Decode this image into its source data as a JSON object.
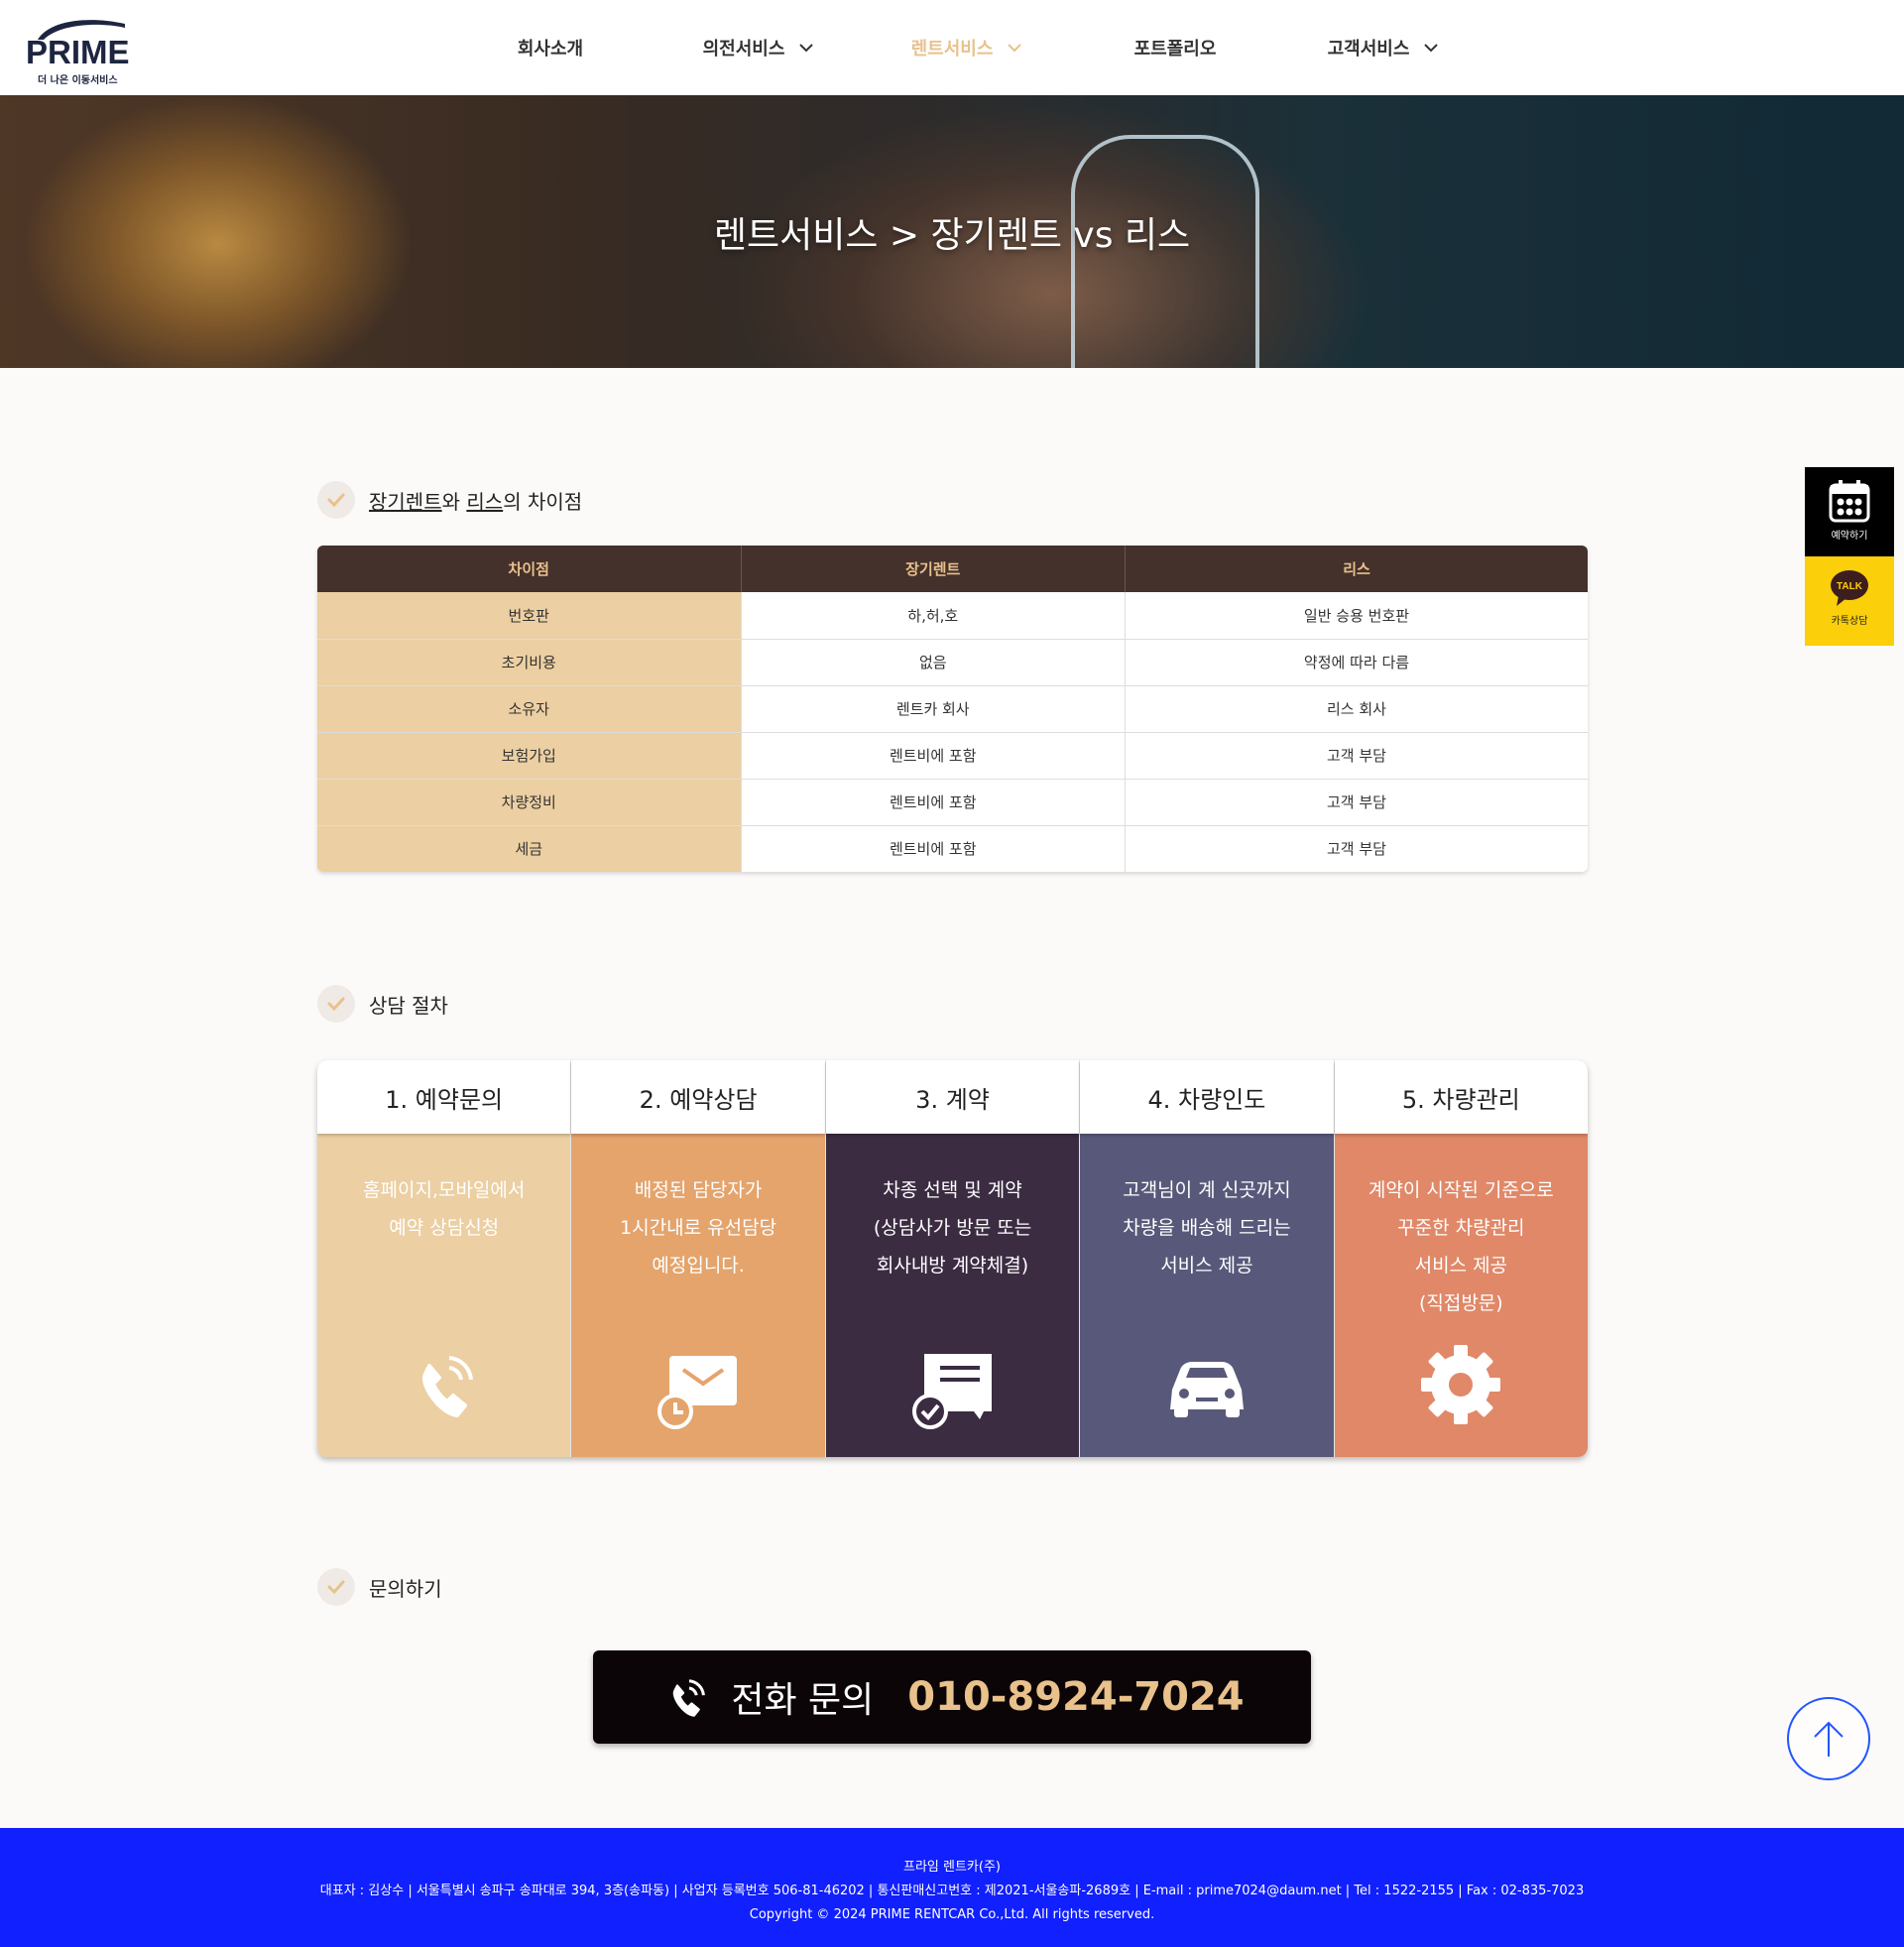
{
  "header": {
    "logo_text": "PRIME",
    "logo_tagline": "더 나은 이동서비스",
    "nav": [
      {
        "label": "회사소개",
        "has_dropdown": false,
        "active": false
      },
      {
        "label": "의전서비스",
        "has_dropdown": true,
        "active": false
      },
      {
        "label": "렌트서비스",
        "has_dropdown": true,
        "active": true
      },
      {
        "label": "포트폴리오",
        "has_dropdown": false,
        "active": false
      },
      {
        "label": "고객서비스",
        "has_dropdown": true,
        "active": false
      }
    ]
  },
  "hero": {
    "title": "렌트서비스 > 장기렌트 vs 리스"
  },
  "comparison": {
    "title_part1": "장기렌트",
    "title_part2": "와 ",
    "title_part3": "리스",
    "title_part4": "의 차이점",
    "headers": [
      "차이점",
      "장기렌트",
      "리스"
    ],
    "rows": [
      [
        "번호판",
        "하,허,호",
        "일반 승용 번호판"
      ],
      [
        "초기비용",
        "없음",
        "약정에 따라 다름"
      ],
      [
        "소유자",
        "렌트카 회사",
        "리스 회사"
      ],
      [
        "보험가입",
        "렌트비에 포함",
        "고객 부담"
      ],
      [
        "차량정비",
        "렌트비에 포함",
        "고객 부담"
      ],
      [
        "세금",
        "렌트비에 포함",
        "고객 부담"
      ]
    ]
  },
  "procedure": {
    "title": "상담 절차",
    "steps": [
      {
        "title": "1. 예약문의",
        "lines": [
          "홈페이지,모바일에서",
          "예약 상담신청"
        ],
        "icon": "phone-icon"
      },
      {
        "title": "2. 예약상담",
        "lines": [
          "배정된 담당자가",
          "1시간내로 유선담당",
          "예정입니다."
        ],
        "icon": "mail-clock-icon"
      },
      {
        "title": "3. 계약",
        "lines": [
          "차종 선택 및 계약",
          "(상담사가 방문 또는",
          "회사내방 계약체결)"
        ],
        "icon": "contract-check-icon"
      },
      {
        "title": "4. 차량인도",
        "lines": [
          "고객님이 계 신곳까지",
          "차량을 배송해 드리는",
          "서비스 제공"
        ],
        "icon": "car-icon"
      },
      {
        "title": "5. 차량관리",
        "lines": [
          "계약이 시작된 기준으로",
          "꾸준한 차량관리",
          "서비스 제공",
          "(직접방문)"
        ],
        "icon": "gear-icon"
      }
    ]
  },
  "inquiry": {
    "title": "문의하기",
    "phone_label": "전화 문의",
    "phone_number": "010-8924-7024"
  },
  "floats": {
    "book_label": "예약하기",
    "talk_badge": "TALK",
    "talk_label": "카톡상담"
  },
  "footer": {
    "company": "프라임 렌트카(주)",
    "info": "대표자 : 김상수 | 서울특별시 송파구 송파대로 394, 3층(송파동) | 사업자 등록번호 506-81-46202 | 통신판매신고번호 : 제2021-서울송파-2689호 | E-mail : prime7024@daum.net | Tel : 1522-2155 | Fax : 02-835-7023",
    "copyright": "Copyright © 2024 PRIME RENTCAR Co.,Ltd. All rights reserved."
  },
  "colors": {
    "accent": "#e9c18b",
    "table_header": "#45312c",
    "footer": "#1120ff"
  }
}
